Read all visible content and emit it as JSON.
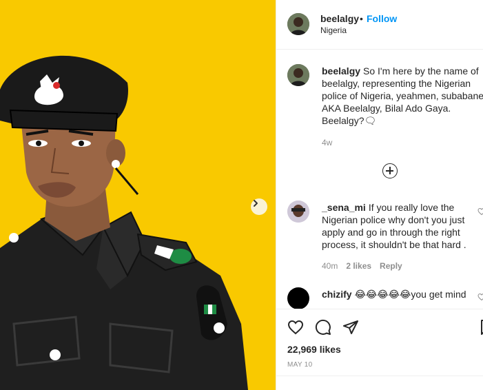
{
  "post": {
    "username": "beelalgy",
    "separator": "•",
    "follow_label": "Follow",
    "location": "Nigeria",
    "caption": "So I'm here by the name of beelalgy, representing the Nigerian police of Nigeria, yeahmen, subabane, AKA Beelalgy, Bilal Ado Gaya. Beelalgy?🗨",
    "caption_time": "4w",
    "likes": "22,969 likes",
    "date": "MAY 10"
  },
  "comments": [
    {
      "username": "_sena_mi",
      "text": "If you really love the Nigerian police why don't you just apply and go in through the right process, it shouldn't be that hard .",
      "time": "40m",
      "likes": "2 likes",
      "reply_label": "Reply"
    },
    {
      "username": "chizify",
      "text": "😂😂😂😂😂you get mind"
    }
  ],
  "icons": {
    "load_more": "plus-circle-icon",
    "next": "chevron-right-icon",
    "like": "heart-icon",
    "comment": "comment-bubble-icon",
    "share": "paper-plane-icon",
    "save": "bookmark-icon"
  },
  "colors": {
    "background_image": "#f9c900",
    "link_blue": "#0095f6",
    "muted_text": "#8e8e8e",
    "uniform": "#1c1c1c"
  }
}
